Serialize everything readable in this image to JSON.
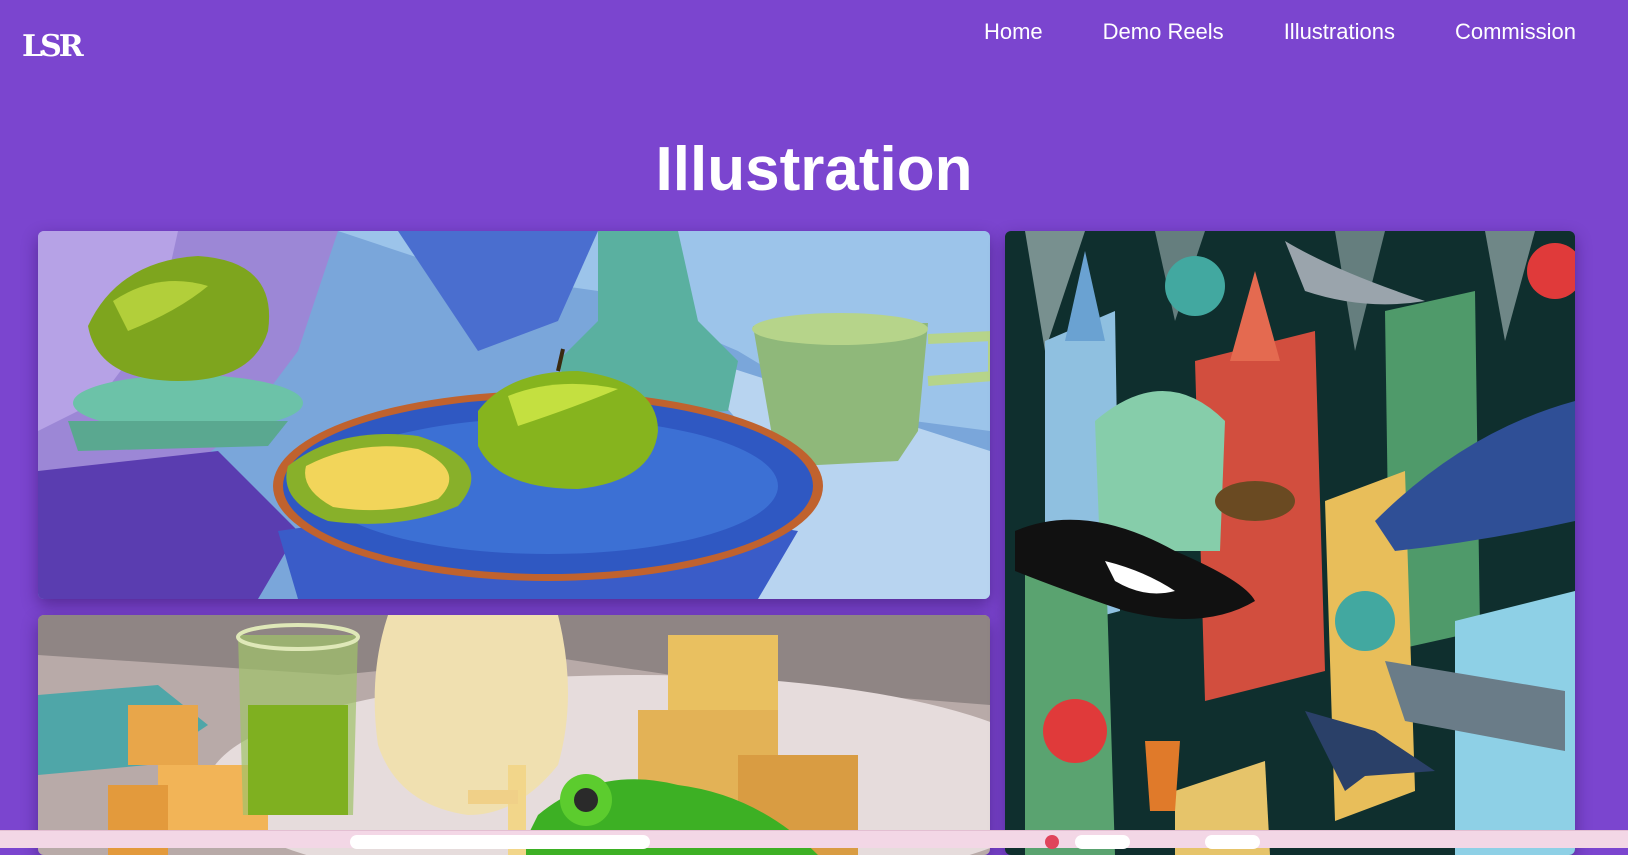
{
  "header": {
    "logo_text": "LSR",
    "nav": [
      {
        "label": "Home"
      },
      {
        "label": "Demo Reels"
      },
      {
        "label": "Illustrations"
      },
      {
        "label": "Commission"
      }
    ]
  },
  "main": {
    "title": "Illustration"
  },
  "gallery": [
    {
      "icon": "still-life-apples-painting"
    },
    {
      "icon": "still-life-blocks-frog-painting"
    },
    {
      "icon": "underwater-city-illustration"
    }
  ],
  "colors": {
    "background": "#7b45cf",
    "nav_text": "#ffffff",
    "taskbar": "#f3d7e6"
  }
}
